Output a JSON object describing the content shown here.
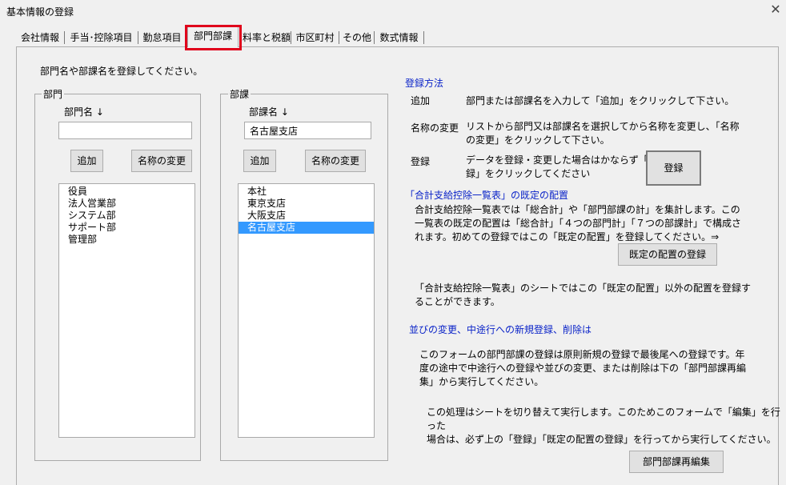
{
  "window": {
    "title": "基本情報の登録",
    "close_glyph": "✕"
  },
  "tabs": [
    {
      "label": "会社情報"
    },
    {
      "label": "手当･控除項目"
    },
    {
      "label": "勤怠項目"
    },
    {
      "label": "部門部課",
      "active": true
    },
    {
      "label": "料率と税額"
    },
    {
      "label": "市区町村"
    },
    {
      "label": "その他"
    },
    {
      "label": "数式情報"
    }
  ],
  "instruction": "部門名や部課名を登録してください。",
  "bumon": {
    "group_label": "部門",
    "field_label": "部門名 ↓",
    "input_value": "",
    "add_label": "追加",
    "rename_label": "名称の変更",
    "items": [
      "役員",
      "法人営業部",
      "システム部",
      "サポート部",
      "管理部"
    ]
  },
  "buka": {
    "group_label": "部課",
    "field_label": "部課名 ↓",
    "input_value": "名古屋支店",
    "add_label": "追加",
    "rename_label": "名称の変更",
    "items": [
      "本社",
      "東京支店",
      "大阪支店",
      "名古屋支店"
    ],
    "selected_index": 3
  },
  "help": {
    "method_heading": "登録方法",
    "add_term": "追加",
    "add_desc": "部門または部課名を入力して「追加」をクリックして下さい。",
    "rename_term": "名称の変更",
    "rename_desc_1": "リストから部門又は部課名を選択してから名称を変更し、「名称",
    "rename_desc_2": "の変更」をクリックして下さい。",
    "register_term": "登録",
    "register_desc_1": "データを登録・変更した場合はかならず「登",
    "register_desc_2": "録」をクリックしてください",
    "register_button": "登録",
    "default_heading": "「合計支給控除一覧表」の既定の配置",
    "default_desc_1": "合計支給控除一覧表では「総合計」や「部門部課の計」を集計します。この",
    "default_desc_2": "一覧表の既定の配置は「総合計」「４つの部門計」「７つの部課計」で構成さ",
    "default_desc_3": "れます。初めての登録ではこの「既定の配置」を登録してください。⇒",
    "default_button": "既定の配置の登録",
    "sheet_desc_1": "「合計支給控除一覧表」のシートではこの「既定の配置」以外の配置を登録す",
    "sheet_desc_2": "ることができます。",
    "reorder_heading": "並びの変更、中途行への新規登録、削除は",
    "reorder_desc_1": "このフォームの部門部課の登録は原則新規の登録で最後尾への登録です。年",
    "reorder_desc_2": "度の途中で中途行への登録や並びの変更、または削除は下の「部門部課再編",
    "reorder_desc_3": "集」から実行してください。",
    "switch_desc_1": "この処理はシートを切り替えて実行します。このためこのフォームで「編集」を行った",
    "switch_desc_2": "場合は、必ず上の「登録」「既定の配置の登録」を行ってから実行してください。",
    "reedit_button": "部門部課再編集"
  }
}
